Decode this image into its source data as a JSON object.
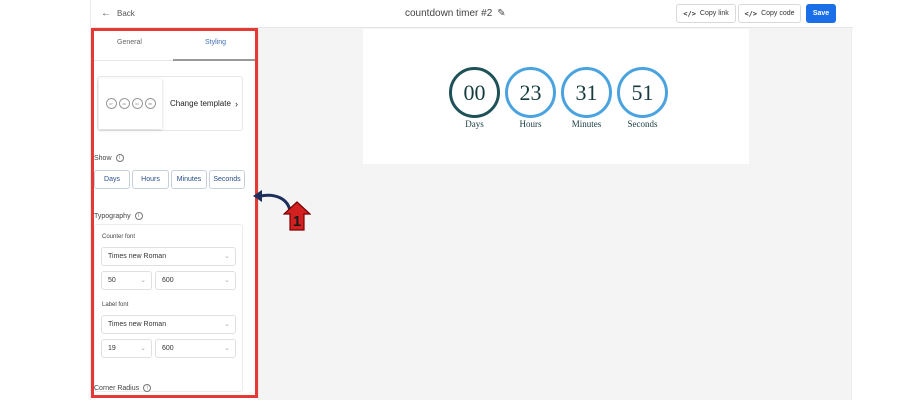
{
  "header": {
    "back_label": "Back",
    "title": "countdown timer #2",
    "copy_link": "Copy link",
    "copy_code": "Copy code",
    "save": "Save"
  },
  "sidebar": {
    "tabs": [
      "General",
      "Styling"
    ],
    "active_tab": "Styling",
    "template_thumb": [
      "07",
      "23",
      "04",
      "08"
    ],
    "change_template": "Change template",
    "show_label": "Show",
    "show_buttons": [
      "Days",
      "Hours",
      "Minutes",
      "Seconds"
    ],
    "typography_label": "Typography",
    "counter_font_label": "Counter font",
    "counter_font": "Times new Roman",
    "counter_size": "50",
    "counter_weight": "600",
    "label_font_label": "Label font",
    "label_font": "Times new Roman",
    "label_size": "19",
    "label_weight": "600",
    "corner_radius_label": "Corner Radius"
  },
  "preview": {
    "units": [
      {
        "value": "00",
        "label": "Days"
      },
      {
        "value": "23",
        "label": "Hours"
      },
      {
        "value": "31",
        "label": "Minutes"
      },
      {
        "value": "51",
        "label": "Seconds"
      }
    ]
  },
  "annotation": {
    "step_number": "1",
    "highlight_color": "#e53935",
    "arrow_color": "#1f2f5c"
  },
  "colors": {
    "accent": "#1a6fe8",
    "ring_blue": "#4aa3df",
    "ring_dark": "#1e5257",
    "text_dark_teal": "#163a3e"
  },
  "icons": {
    "back": "arrow-left-icon",
    "edit": "pencil-icon",
    "code": "code-icon",
    "info": "info-icon",
    "dropdown": "chevron-down-icon"
  }
}
